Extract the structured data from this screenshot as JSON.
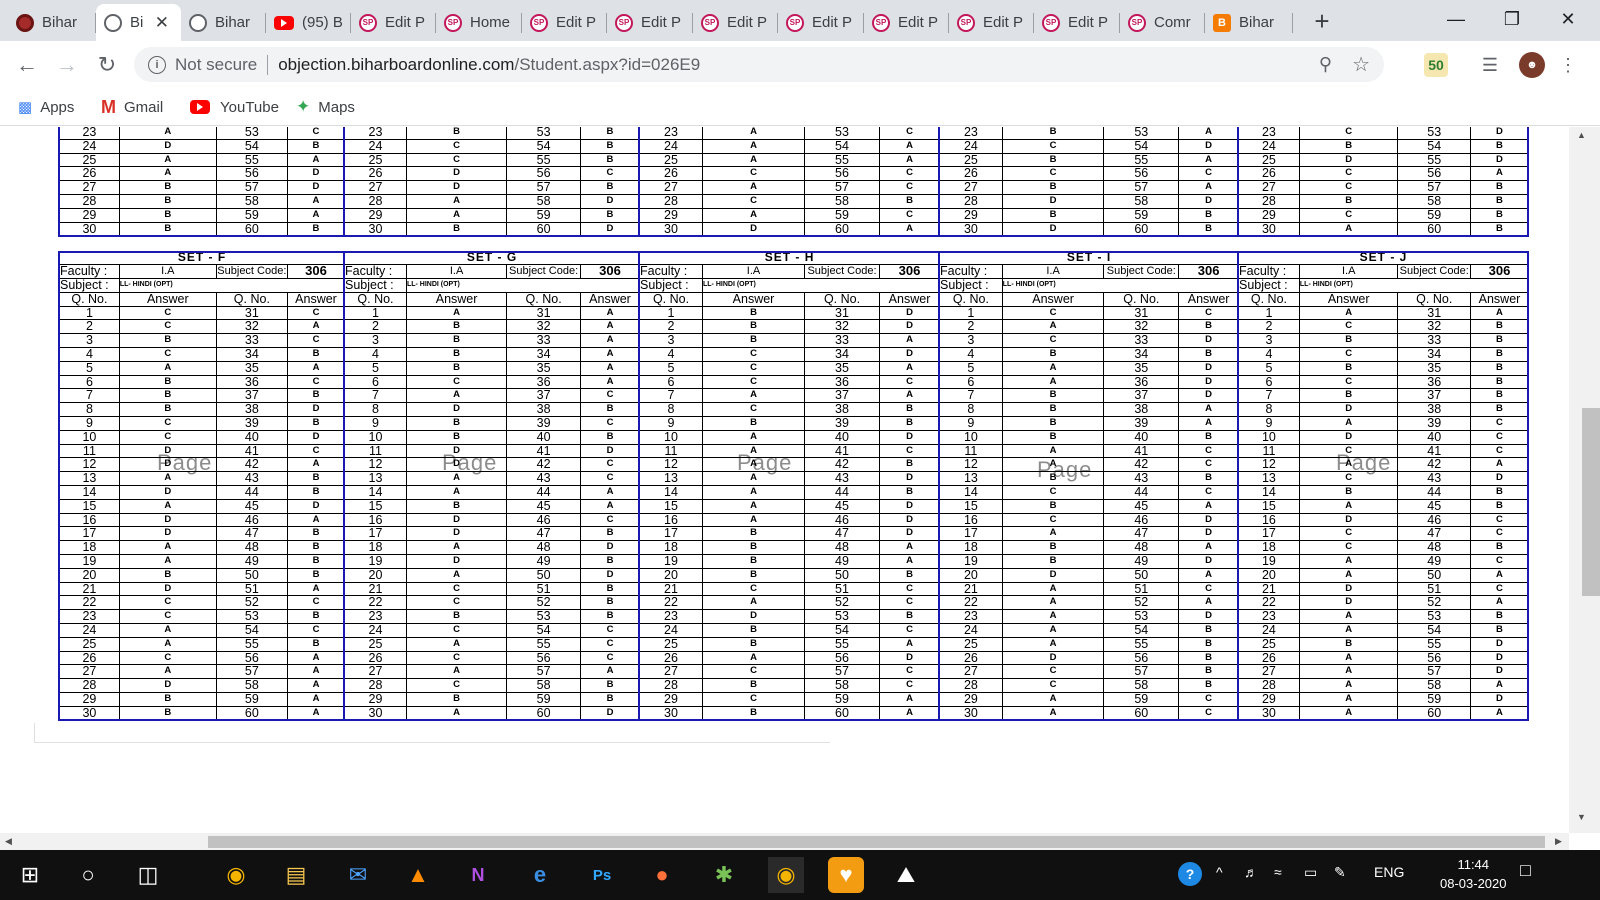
{
  "tabs": [
    {
      "label": "Bihar",
      "icon": "bihar"
    },
    {
      "label": "Bi",
      "icon": "globe",
      "active": true
    },
    {
      "label": "Bihar",
      "icon": "globe"
    },
    {
      "label": "(95) B",
      "icon": "youtube"
    },
    {
      "label": "Edit P",
      "icon": "sp"
    },
    {
      "label": "Home",
      "icon": "sp"
    },
    {
      "label": "Edit P",
      "icon": "sp"
    },
    {
      "label": "Edit P",
      "icon": "sp"
    },
    {
      "label": "Edit P",
      "icon": "sp"
    },
    {
      "label": "Edit P",
      "icon": "sp"
    },
    {
      "label": "Edit P",
      "icon": "sp"
    },
    {
      "label": "Edit P",
      "icon": "sp"
    },
    {
      "label": "Edit P",
      "icon": "sp"
    },
    {
      "label": "Comr",
      "icon": "sp"
    },
    {
      "label": "Bihar",
      "icon": "blogger"
    }
  ],
  "address": {
    "security": "Not secure",
    "domain": "objection.biharboardonline.com",
    "path": "/Student.aspx?id=026E9"
  },
  "bookmarks": [
    {
      "label": "Apps"
    },
    {
      "label": "Gmail"
    },
    {
      "label": "YouTube"
    },
    {
      "label": "Maps"
    }
  ],
  "extension_badge": "50",
  "top_sets": [
    {
      "rows": [
        [
          "23",
          "A",
          "53",
          "C"
        ],
        [
          "24",
          "D",
          "54",
          "B"
        ],
        [
          "25",
          "A",
          "55",
          "A"
        ],
        [
          "26",
          "A",
          "56",
          "D"
        ],
        [
          "27",
          "B",
          "57",
          "D"
        ],
        [
          "28",
          "B",
          "58",
          "A"
        ],
        [
          "29",
          "B",
          "59",
          "A"
        ],
        [
          "30",
          "B",
          "60",
          "B"
        ]
      ]
    },
    {
      "rows": [
        [
          "23",
          "B",
          "53",
          "B"
        ],
        [
          "24",
          "C",
          "54",
          "B"
        ],
        [
          "25",
          "C",
          "55",
          "B"
        ],
        [
          "26",
          "D",
          "56",
          "C"
        ],
        [
          "27",
          "D",
          "57",
          "B"
        ],
        [
          "28",
          "A",
          "58",
          "D"
        ],
        [
          "29",
          "A",
          "59",
          "B"
        ],
        [
          "30",
          "B",
          "60",
          "D"
        ]
      ]
    },
    {
      "rows": [
        [
          "23",
          "A",
          "53",
          "C"
        ],
        [
          "24",
          "A",
          "54",
          "A"
        ],
        [
          "25",
          "A",
          "55",
          "A"
        ],
        [
          "26",
          "C",
          "56",
          "C"
        ],
        [
          "27",
          "A",
          "57",
          "C"
        ],
        [
          "28",
          "C",
          "58",
          "B"
        ],
        [
          "29",
          "A",
          "59",
          "C"
        ],
        [
          "30",
          "D",
          "60",
          "A"
        ]
      ]
    },
    {
      "rows": [
        [
          "23",
          "B",
          "53",
          "A"
        ],
        [
          "24",
          "C",
          "54",
          "D"
        ],
        [
          "25",
          "B",
          "55",
          "A"
        ],
        [
          "26",
          "C",
          "56",
          "C"
        ],
        [
          "27",
          "B",
          "57",
          "A"
        ],
        [
          "28",
          "D",
          "58",
          "D"
        ],
        [
          "29",
          "B",
          "59",
          "B"
        ],
        [
          "30",
          "D",
          "60",
          "B"
        ]
      ]
    },
    {
      "rows": [
        [
          "23",
          "C",
          "53",
          "D"
        ],
        [
          "24",
          "B",
          "54",
          "B"
        ],
        [
          "25",
          "D",
          "55",
          "D"
        ],
        [
          "26",
          "C",
          "56",
          "A"
        ],
        [
          "27",
          "C",
          "57",
          "B"
        ],
        [
          "28",
          "B",
          "58",
          "B"
        ],
        [
          "29",
          "C",
          "59",
          "B"
        ],
        [
          "30",
          "A",
          "60",
          "B"
        ]
      ]
    }
  ],
  "sets": [
    {
      "title": "SET - F",
      "faculty_label": "Faculty :",
      "faculty": "I.A",
      "code_label": "Subject Code:",
      "code": "306",
      "subject_label": "Subject :",
      "subject": "LL- HINDI (OPT)",
      "headers": [
        "Q. No.",
        "Answer",
        "Q. No.",
        "Answer"
      ],
      "watermark": "Page",
      "rows": [
        [
          "1",
          "C",
          "31",
          "C"
        ],
        [
          "2",
          "C",
          "32",
          "A"
        ],
        [
          "3",
          "B",
          "33",
          "C"
        ],
        [
          "4",
          "C",
          "34",
          "B"
        ],
        [
          "5",
          "A",
          "35",
          "A"
        ],
        [
          "6",
          "B",
          "36",
          "C"
        ],
        [
          "7",
          "B",
          "37",
          "B"
        ],
        [
          "8",
          "B",
          "38",
          "D"
        ],
        [
          "9",
          "C",
          "39",
          "B"
        ],
        [
          "10",
          "C",
          "40",
          "D"
        ],
        [
          "11",
          "D",
          "41",
          "C"
        ],
        [
          "12",
          "D",
          "42",
          "A"
        ],
        [
          "13",
          "A",
          "43",
          "B"
        ],
        [
          "14",
          "D",
          "44",
          "B"
        ],
        [
          "15",
          "A",
          "45",
          "D"
        ],
        [
          "16",
          "D",
          "46",
          "A"
        ],
        [
          "17",
          "D",
          "47",
          "B"
        ],
        [
          "18",
          "A",
          "48",
          "B"
        ],
        [
          "19",
          "A",
          "49",
          "B"
        ],
        [
          "20",
          "B",
          "50",
          "B"
        ],
        [
          "21",
          "D",
          "51",
          "A"
        ],
        [
          "22",
          "C",
          "52",
          "C"
        ],
        [
          "23",
          "C",
          "53",
          "B"
        ],
        [
          "24",
          "A",
          "54",
          "C"
        ],
        [
          "25",
          "A",
          "55",
          "B"
        ],
        [
          "26",
          "C",
          "56",
          "A"
        ],
        [
          "27",
          "A",
          "57",
          "A"
        ],
        [
          "28",
          "D",
          "58",
          "A"
        ],
        [
          "29",
          "B",
          "59",
          "A"
        ],
        [
          "30",
          "B",
          "60",
          "A"
        ]
      ]
    },
    {
      "title": "SET - G",
      "faculty_label": "Faculty :",
      "faculty": "I.A",
      "code_label": "Subject Code:",
      "code": "306",
      "subject_label": "Subject :",
      "subject": "LL- HINDI (OPT)",
      "headers": [
        "Q. No.",
        "Answer",
        "Q. No.",
        "Answer"
      ],
      "watermark": "Page",
      "rows": [
        [
          "1",
          "A",
          "31",
          "A"
        ],
        [
          "2",
          "B",
          "32",
          "A"
        ],
        [
          "3",
          "B",
          "33",
          "A"
        ],
        [
          "4",
          "B",
          "34",
          "A"
        ],
        [
          "5",
          "B",
          "35",
          "A"
        ],
        [
          "6",
          "C",
          "36",
          "A"
        ],
        [
          "7",
          "A",
          "37",
          "C"
        ],
        [
          "8",
          "D",
          "38",
          "B"
        ],
        [
          "9",
          "B",
          "39",
          "C"
        ],
        [
          "10",
          "B",
          "40",
          "B"
        ],
        [
          "11",
          "D",
          "41",
          "D"
        ],
        [
          "12",
          "D",
          "42",
          "C"
        ],
        [
          "13",
          "A",
          "43",
          "C"
        ],
        [
          "14",
          "A",
          "44",
          "A"
        ],
        [
          "15",
          "B",
          "45",
          "A"
        ],
        [
          "16",
          "D",
          "46",
          "C"
        ],
        [
          "17",
          "D",
          "47",
          "B"
        ],
        [
          "18",
          "A",
          "48",
          "D"
        ],
        [
          "19",
          "D",
          "49",
          "B"
        ],
        [
          "20",
          "A",
          "50",
          "D"
        ],
        [
          "21",
          "C",
          "51",
          "B"
        ],
        [
          "22",
          "C",
          "52",
          "B"
        ],
        [
          "23",
          "B",
          "53",
          "B"
        ],
        [
          "24",
          "C",
          "54",
          "C"
        ],
        [
          "25",
          "A",
          "55",
          "C"
        ],
        [
          "26",
          "C",
          "56",
          "C"
        ],
        [
          "27",
          "A",
          "57",
          "A"
        ],
        [
          "28",
          "C",
          "58",
          "B"
        ],
        [
          "29",
          "B",
          "59",
          "B"
        ],
        [
          "30",
          "A",
          "60",
          "D"
        ]
      ]
    },
    {
      "title": "SET - H",
      "faculty_label": "Faculty :",
      "faculty": "I.A",
      "code_label": "Subject Code:",
      "code": "306",
      "subject_label": "Subject :",
      "subject": "LL- HINDI (OPT)",
      "headers": [
        "Q. No.",
        "Answer",
        "Q. No.",
        "Answer"
      ],
      "watermark": "Page",
      "rows": [
        [
          "1",
          "B",
          "31",
          "D"
        ],
        [
          "2",
          "B",
          "32",
          "D"
        ],
        [
          "3",
          "B",
          "33",
          "A"
        ],
        [
          "4",
          "C",
          "34",
          "D"
        ],
        [
          "5",
          "C",
          "35",
          "A"
        ],
        [
          "6",
          "C",
          "36",
          "C"
        ],
        [
          "7",
          "A",
          "37",
          "A"
        ],
        [
          "8",
          "C",
          "38",
          "B"
        ],
        [
          "9",
          "B",
          "39",
          "B"
        ],
        [
          "10",
          "A",
          "40",
          "D"
        ],
        [
          "11",
          "A",
          "41",
          "C"
        ],
        [
          "12",
          "A",
          "42",
          "B"
        ],
        [
          "13",
          "A",
          "43",
          "D"
        ],
        [
          "14",
          "A",
          "44",
          "B"
        ],
        [
          "15",
          "A",
          "45",
          "D"
        ],
        [
          "16",
          "A",
          "46",
          "D"
        ],
        [
          "17",
          "B",
          "47",
          "D"
        ],
        [
          "18",
          "B",
          "48",
          "A"
        ],
        [
          "19",
          "B",
          "49",
          "A"
        ],
        [
          "20",
          "B",
          "50",
          "B"
        ],
        [
          "21",
          "C",
          "51",
          "C"
        ],
        [
          "22",
          "A",
          "52",
          "C"
        ],
        [
          "23",
          "D",
          "53",
          "B"
        ],
        [
          "24",
          "B",
          "54",
          "C"
        ],
        [
          "25",
          "B",
          "55",
          "A"
        ],
        [
          "26",
          "A",
          "56",
          "D"
        ],
        [
          "27",
          "C",
          "57",
          "C"
        ],
        [
          "28",
          "B",
          "58",
          "C"
        ],
        [
          "29",
          "C",
          "59",
          "A"
        ],
        [
          "30",
          "B",
          "60",
          "A"
        ]
      ]
    },
    {
      "title": "SET - I",
      "faculty_label": "Faculty :",
      "faculty": "I.A",
      "code_label": "Subject Code:",
      "code": "306",
      "subject_label": "Subject :",
      "subject": "LL- HINDI (OPT)",
      "headers": [
        "Q. No.",
        "Answer",
        "Q. No.",
        "Answer"
      ],
      "watermark": "Page",
      "rows": [
        [
          "1",
          "C",
          "31",
          "C"
        ],
        [
          "2",
          "A",
          "32",
          "B"
        ],
        [
          "3",
          "C",
          "33",
          "D"
        ],
        [
          "4",
          "B",
          "34",
          "B"
        ],
        [
          "5",
          "A",
          "35",
          "D"
        ],
        [
          "6",
          "A",
          "36",
          "D"
        ],
        [
          "7",
          "B",
          "37",
          "D"
        ],
        [
          "8",
          "B",
          "38",
          "A"
        ],
        [
          "9",
          "B",
          "39",
          "A"
        ],
        [
          "10",
          "B",
          "40",
          "B"
        ],
        [
          "11",
          "A",
          "41",
          "C"
        ],
        [
          "12",
          "A",
          "42",
          "C"
        ],
        [
          "13",
          "B",
          "43",
          "B"
        ],
        [
          "14",
          "C",
          "44",
          "C"
        ],
        [
          "15",
          "B",
          "45",
          "A"
        ],
        [
          "16",
          "C",
          "46",
          "D"
        ],
        [
          "17",
          "A",
          "47",
          "D"
        ],
        [
          "18",
          "B",
          "48",
          "A"
        ],
        [
          "19",
          "B",
          "49",
          "D"
        ],
        [
          "20",
          "D",
          "50",
          "A"
        ],
        [
          "21",
          "A",
          "51",
          "C"
        ],
        [
          "22",
          "A",
          "52",
          "A"
        ],
        [
          "23",
          "A",
          "53",
          "D"
        ],
        [
          "24",
          "A",
          "54",
          "B"
        ],
        [
          "25",
          "A",
          "55",
          "B"
        ],
        [
          "26",
          "D",
          "56",
          "B"
        ],
        [
          "27",
          "C",
          "57",
          "B"
        ],
        [
          "28",
          "C",
          "58",
          "B"
        ],
        [
          "29",
          "A",
          "59",
          "C"
        ],
        [
          "30",
          "A",
          "60",
          "C"
        ]
      ]
    },
    {
      "title": "SET - J",
      "faculty_label": "Faculty :",
      "faculty": "I.A",
      "code_label": "Subject Code:",
      "code": "306",
      "subject_label": "Subject :",
      "subject": "LL- HINDI (OPT)",
      "headers": [
        "Q. No.",
        "Answer",
        "Q. No.",
        "Answer"
      ],
      "watermark": "Page",
      "rows": [
        [
          "1",
          "A",
          "31",
          "A"
        ],
        [
          "2",
          "C",
          "32",
          "B"
        ],
        [
          "3",
          "B",
          "33",
          "B"
        ],
        [
          "4",
          "C",
          "34",
          "B"
        ],
        [
          "5",
          "B",
          "35",
          "B"
        ],
        [
          "6",
          "C",
          "36",
          "B"
        ],
        [
          "7",
          "B",
          "37",
          "B"
        ],
        [
          "8",
          "D",
          "38",
          "B"
        ],
        [
          "9",
          "A",
          "39",
          "C"
        ],
        [
          "10",
          "D",
          "40",
          "C"
        ],
        [
          "11",
          "C",
          "41",
          "C"
        ],
        [
          "12",
          "A",
          "42",
          "A"
        ],
        [
          "13",
          "C",
          "43",
          "D"
        ],
        [
          "14",
          "B",
          "44",
          "B"
        ],
        [
          "15",
          "A",
          "45",
          "B"
        ],
        [
          "16",
          "D",
          "46",
          "C"
        ],
        [
          "17",
          "C",
          "47",
          "C"
        ],
        [
          "18",
          "C",
          "48",
          "B"
        ],
        [
          "19",
          "A",
          "49",
          "C"
        ],
        [
          "20",
          "A",
          "50",
          "A"
        ],
        [
          "21",
          "D",
          "51",
          "C"
        ],
        [
          "22",
          "D",
          "52",
          "A"
        ],
        [
          "23",
          "A",
          "53",
          "B"
        ],
        [
          "24",
          "A",
          "54",
          "B"
        ],
        [
          "25",
          "B",
          "55",
          "D"
        ],
        [
          "26",
          "A",
          "56",
          "D"
        ],
        [
          "27",
          "A",
          "57",
          "D"
        ],
        [
          "28",
          "A",
          "58",
          "A"
        ],
        [
          "29",
          "A",
          "59",
          "D"
        ],
        [
          "30",
          "A",
          "60",
          "A"
        ]
      ]
    }
  ],
  "taskbar": {
    "language": "ENG",
    "time": "11:44",
    "date": "08-03-2020"
  }
}
